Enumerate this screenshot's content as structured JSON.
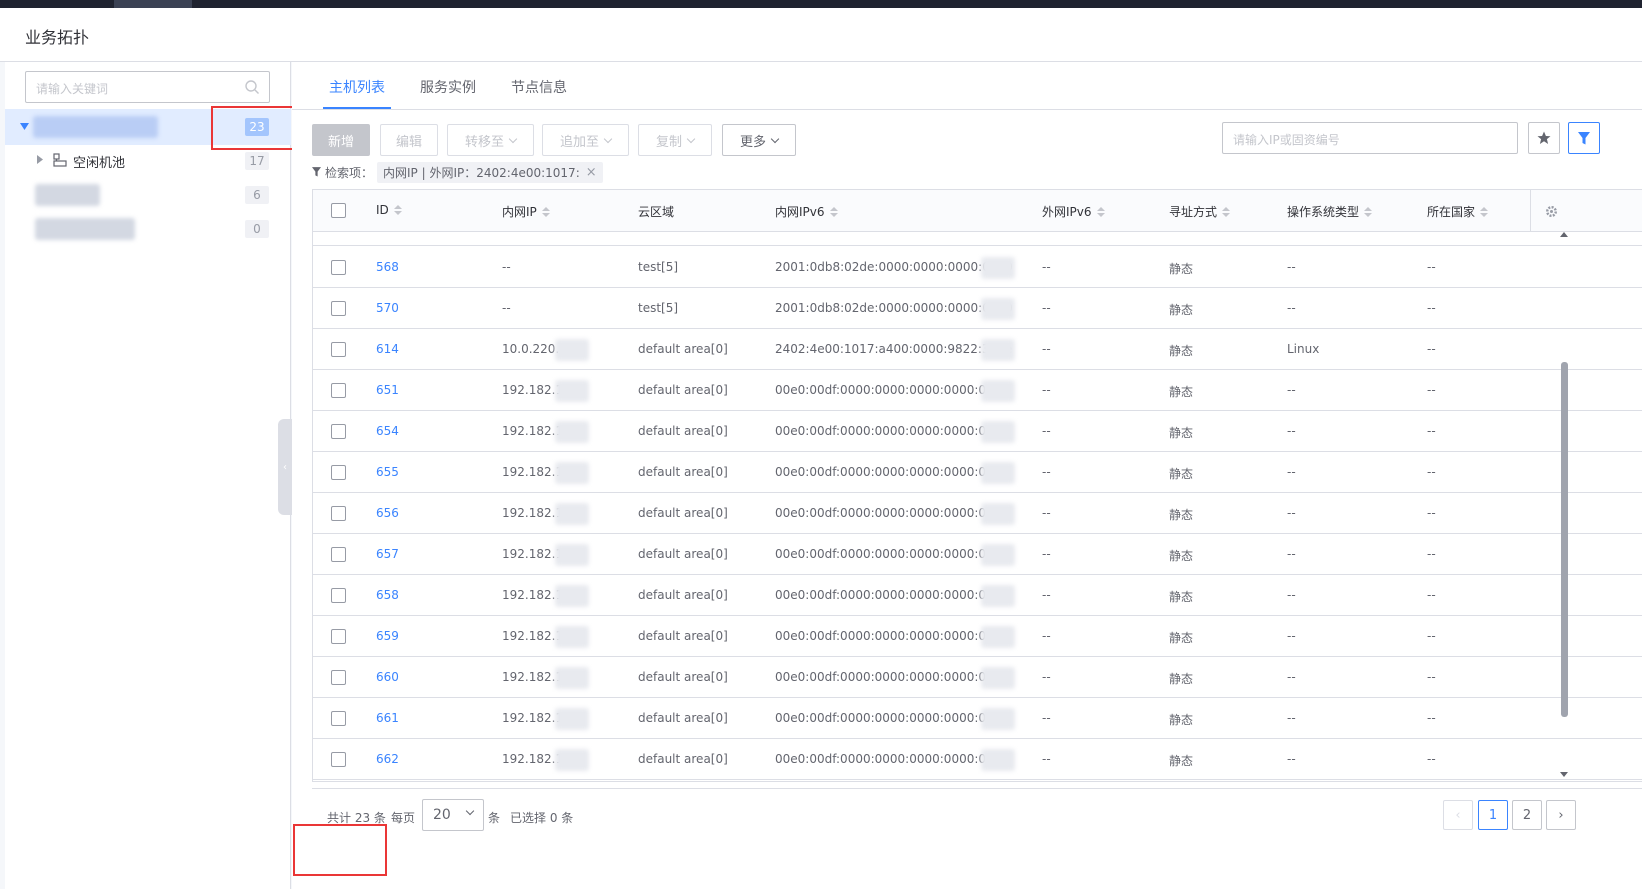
{
  "header": {
    "title": "业务拓扑"
  },
  "sidebar": {
    "search_placeholder": "请输入关键词",
    "nodes": [
      {
        "label": "",
        "count": "23"
      },
      {
        "label": "空闲机池",
        "count": "17"
      },
      {
        "label": "",
        "count": "6"
      },
      {
        "label": "",
        "count": "0"
      }
    ]
  },
  "tabs": [
    "主机列表",
    "服务实例",
    "节点信息"
  ],
  "toolbar": {
    "add": "新增",
    "edit": "编辑",
    "transfer": "转移至",
    "append": "追加至",
    "copy": "复制",
    "more": "更多",
    "ip_search_placeholder": "请输入IP或固资编号"
  },
  "filter": {
    "label": "检索项：",
    "chip": "内网IP | 外网IP：2402:4e00:1017:"
  },
  "table": {
    "columns": [
      "ID",
      "内网IP",
      "云区域",
      "内网IPv6",
      "外网IPv6",
      "寻址方式",
      "操作系统类型",
      "所在国家"
    ],
    "rows": [
      {
        "id": "568",
        "ip": "--",
        "area": "test[5]",
        "ipv6": "2001:0db8:02de:0000:0000:0000:0000",
        "ext": "--",
        "addr": "静态",
        "os": "--",
        "country": "--"
      },
      {
        "id": "570",
        "ip": "--",
        "area": "test[5]",
        "ipv6": "2001:0db8:02de:0000:0000:0000:0000",
        "ext": "--",
        "addr": "静态",
        "os": "--",
        "country": "--"
      },
      {
        "id": "614",
        "ip": "10.0.220.",
        "area": "default area[0]",
        "ipv6": "2402:4e00:1017:a400:0000:9822:382e",
        "ext": "--",
        "addr": "静态",
        "os": "Linux",
        "country": "--"
      },
      {
        "id": "651",
        "ip": "192.182.1",
        "area": "default area[0]",
        "ipv6": "00e0:00df:0000:0000:0000:0000:0000",
        "ext": "--",
        "addr": "静态",
        "os": "--",
        "country": "--"
      },
      {
        "id": "654",
        "ip": "192.182.1",
        "area": "default area[0]",
        "ipv6": "00e0:00df:0000:0000:0000:0000:0000",
        "ext": "--",
        "addr": "静态",
        "os": "--",
        "country": "--"
      },
      {
        "id": "655",
        "ip": "192.182.1",
        "area": "default area[0]",
        "ipv6": "00e0:00df:0000:0000:0000:0000:0000",
        "ext": "--",
        "addr": "静态",
        "os": "--",
        "country": "--"
      },
      {
        "id": "656",
        "ip": "192.182.1",
        "area": "default area[0]",
        "ipv6": "00e0:00df:0000:0000:0000:0000:000",
        "ext": "--",
        "addr": "静态",
        "os": "--",
        "country": "--"
      },
      {
        "id": "657",
        "ip": "192.182.1",
        "area": "default area[0]",
        "ipv6": "00e0:00df:0000:0000:0000:0000:0000",
        "ext": "--",
        "addr": "静态",
        "os": "--",
        "country": "--"
      },
      {
        "id": "658",
        "ip": "192.182.1",
        "area": "default area[0]",
        "ipv6": "00e0:00df:0000:0000:0000:0000:0000",
        "ext": "--",
        "addr": "静态",
        "os": "--",
        "country": "--"
      },
      {
        "id": "659",
        "ip": "192.182.1",
        "area": "default area[0]",
        "ipv6": "00e0:00df:0000:0000:0000:0000:0000",
        "ext": "--",
        "addr": "静态",
        "os": "--",
        "country": "--"
      },
      {
        "id": "660",
        "ip": "192.182.1",
        "area": "default area[0]",
        "ipv6": "00e0:00df:0000:0000:0000:0000:000",
        "ext": "--",
        "addr": "静态",
        "os": "--",
        "country": "--"
      },
      {
        "id": "661",
        "ip": "192.182.1",
        "area": "default area[0]",
        "ipv6": "00e0:00df:0000:0000:0000:0000:000",
        "ext": "--",
        "addr": "静态",
        "os": "--",
        "country": "--"
      },
      {
        "id": "662",
        "ip": "192.182.1",
        "area": "default area[0]",
        "ipv6": "00e0:00df:0000:0000:0000:0000:000",
        "ext": "--",
        "addr": "静态",
        "os": "--",
        "country": "--"
      }
    ]
  },
  "footer": {
    "total": "共计 23 条",
    "per_page_label": "每页",
    "per_page_value": "20",
    "unit": "条",
    "selected": "已选择 0 条",
    "pages": [
      "1",
      "2"
    ]
  },
  "colors": {
    "accent": "#3a84ff",
    "highlight_border": "#ea3636"
  }
}
